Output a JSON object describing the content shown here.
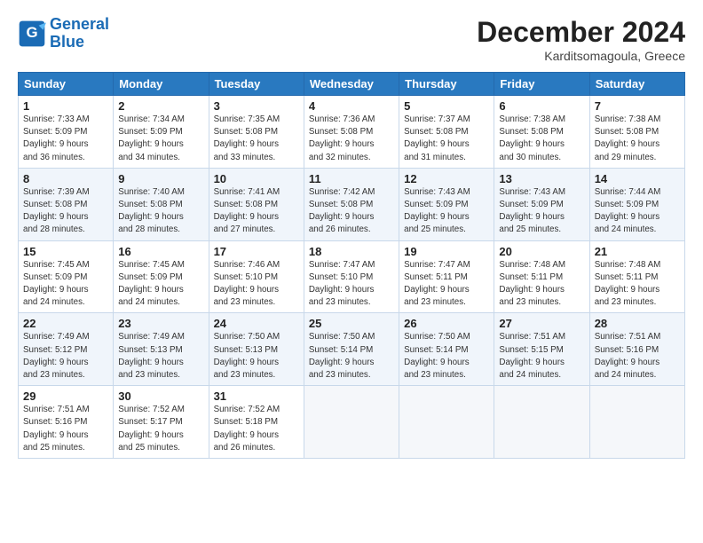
{
  "logo": {
    "line1": "General",
    "line2": "Blue"
  },
  "title": "December 2024",
  "subtitle": "Karditsomagoula, Greece",
  "weekdays": [
    "Sunday",
    "Monday",
    "Tuesday",
    "Wednesday",
    "Thursday",
    "Friday",
    "Saturday"
  ],
  "weeks": [
    [
      {
        "day": "1",
        "sunrise": "7:33 AM",
        "sunset": "5:09 PM",
        "daylight": "9 hours and 36 minutes."
      },
      {
        "day": "2",
        "sunrise": "7:34 AM",
        "sunset": "5:09 PM",
        "daylight": "9 hours and 34 minutes."
      },
      {
        "day": "3",
        "sunrise": "7:35 AM",
        "sunset": "5:08 PM",
        "daylight": "9 hours and 33 minutes."
      },
      {
        "day": "4",
        "sunrise": "7:36 AM",
        "sunset": "5:08 PM",
        "daylight": "9 hours and 32 minutes."
      },
      {
        "day": "5",
        "sunrise": "7:37 AM",
        "sunset": "5:08 PM",
        "daylight": "9 hours and 31 minutes."
      },
      {
        "day": "6",
        "sunrise": "7:38 AM",
        "sunset": "5:08 PM",
        "daylight": "9 hours and 30 minutes."
      },
      {
        "day": "7",
        "sunrise": "7:38 AM",
        "sunset": "5:08 PM",
        "daylight": "9 hours and 29 minutes."
      }
    ],
    [
      {
        "day": "8",
        "sunrise": "7:39 AM",
        "sunset": "5:08 PM",
        "daylight": "9 hours and 28 minutes."
      },
      {
        "day": "9",
        "sunrise": "7:40 AM",
        "sunset": "5:08 PM",
        "daylight": "9 hours and 28 minutes."
      },
      {
        "day": "10",
        "sunrise": "7:41 AM",
        "sunset": "5:08 PM",
        "daylight": "9 hours and 27 minutes."
      },
      {
        "day": "11",
        "sunrise": "7:42 AM",
        "sunset": "5:08 PM",
        "daylight": "9 hours and 26 minutes."
      },
      {
        "day": "12",
        "sunrise": "7:43 AM",
        "sunset": "5:09 PM",
        "daylight": "9 hours and 25 minutes."
      },
      {
        "day": "13",
        "sunrise": "7:43 AM",
        "sunset": "5:09 PM",
        "daylight": "9 hours and 25 minutes."
      },
      {
        "day": "14",
        "sunrise": "7:44 AM",
        "sunset": "5:09 PM",
        "daylight": "9 hours and 24 minutes."
      }
    ],
    [
      {
        "day": "15",
        "sunrise": "7:45 AM",
        "sunset": "5:09 PM",
        "daylight": "9 hours and 24 minutes."
      },
      {
        "day": "16",
        "sunrise": "7:45 AM",
        "sunset": "5:09 PM",
        "daylight": "9 hours and 24 minutes."
      },
      {
        "day": "17",
        "sunrise": "7:46 AM",
        "sunset": "5:10 PM",
        "daylight": "9 hours and 23 minutes."
      },
      {
        "day": "18",
        "sunrise": "7:47 AM",
        "sunset": "5:10 PM",
        "daylight": "9 hours and 23 minutes."
      },
      {
        "day": "19",
        "sunrise": "7:47 AM",
        "sunset": "5:11 PM",
        "daylight": "9 hours and 23 minutes."
      },
      {
        "day": "20",
        "sunrise": "7:48 AM",
        "sunset": "5:11 PM",
        "daylight": "9 hours and 23 minutes."
      },
      {
        "day": "21",
        "sunrise": "7:48 AM",
        "sunset": "5:11 PM",
        "daylight": "9 hours and 23 minutes."
      }
    ],
    [
      {
        "day": "22",
        "sunrise": "7:49 AM",
        "sunset": "5:12 PM",
        "daylight": "9 hours and 23 minutes."
      },
      {
        "day": "23",
        "sunrise": "7:49 AM",
        "sunset": "5:13 PM",
        "daylight": "9 hours and 23 minutes."
      },
      {
        "day": "24",
        "sunrise": "7:50 AM",
        "sunset": "5:13 PM",
        "daylight": "9 hours and 23 minutes."
      },
      {
        "day": "25",
        "sunrise": "7:50 AM",
        "sunset": "5:14 PM",
        "daylight": "9 hours and 23 minutes."
      },
      {
        "day": "26",
        "sunrise": "7:50 AM",
        "sunset": "5:14 PM",
        "daylight": "9 hours and 23 minutes."
      },
      {
        "day": "27",
        "sunrise": "7:51 AM",
        "sunset": "5:15 PM",
        "daylight": "9 hours and 24 minutes."
      },
      {
        "day": "28",
        "sunrise": "7:51 AM",
        "sunset": "5:16 PM",
        "daylight": "9 hours and 24 minutes."
      }
    ],
    [
      {
        "day": "29",
        "sunrise": "7:51 AM",
        "sunset": "5:16 PM",
        "daylight": "9 hours and 25 minutes."
      },
      {
        "day": "30",
        "sunrise": "7:52 AM",
        "sunset": "5:17 PM",
        "daylight": "9 hours and 25 minutes."
      },
      {
        "day": "31",
        "sunrise": "7:52 AM",
        "sunset": "5:18 PM",
        "daylight": "9 hours and 26 minutes."
      },
      null,
      null,
      null,
      null
    ]
  ],
  "labels": {
    "sunrise": "Sunrise:",
    "sunset": "Sunset:",
    "daylight": "Daylight hours"
  }
}
